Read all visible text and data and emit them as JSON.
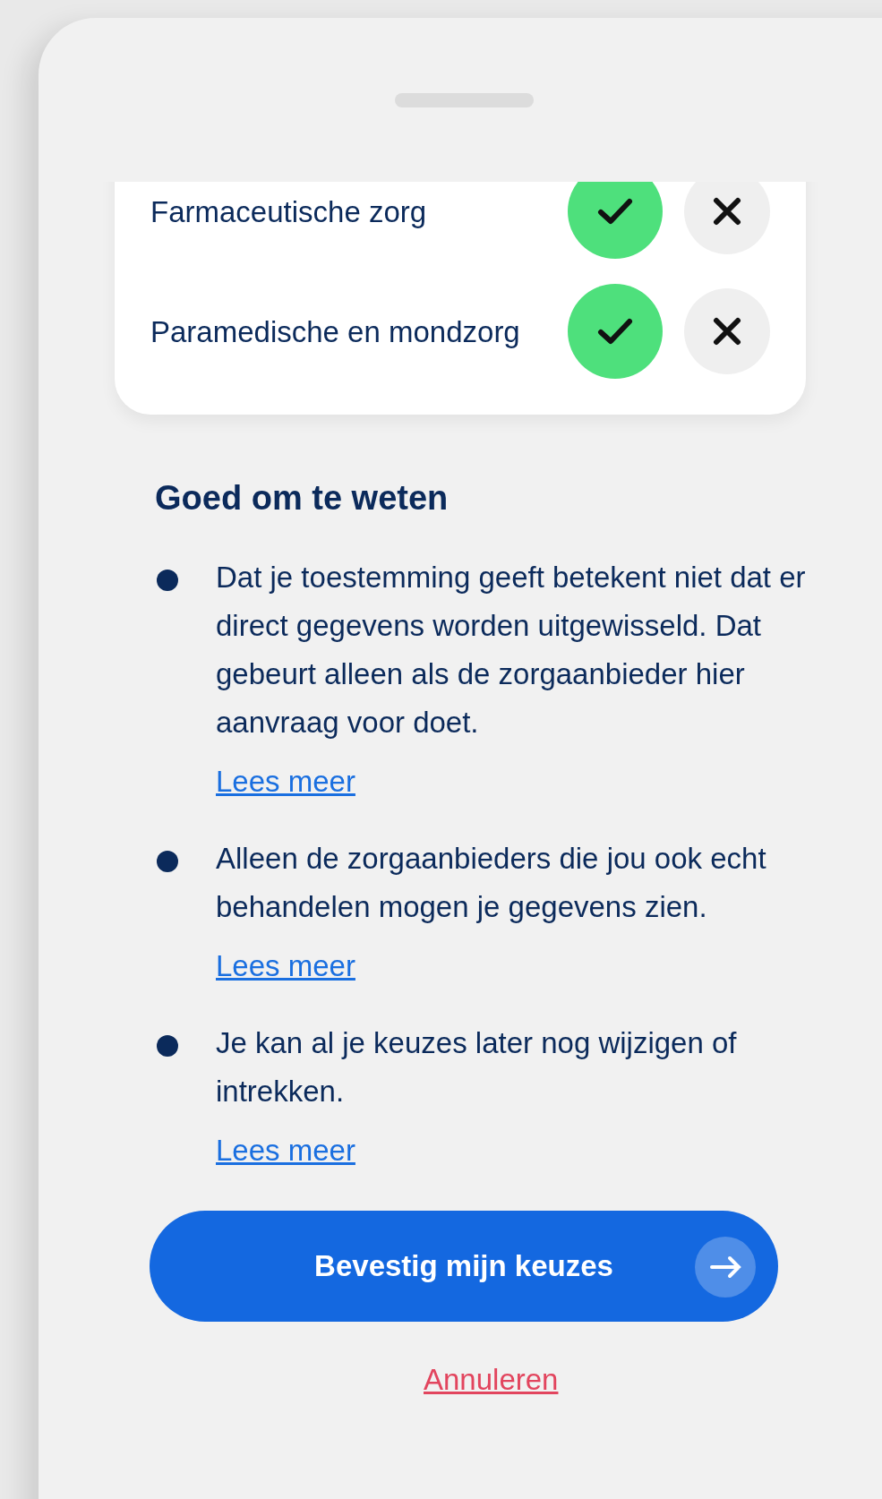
{
  "consents": [
    {
      "label": "Farmaceutische zorg",
      "options": [
        {
          "kind": "accept",
          "selected": true
        },
        {
          "kind": "reject",
          "selected": false
        }
      ]
    },
    {
      "label": "Paramedische en mondzorg",
      "options": [
        {
          "kind": "accept",
          "selected": true
        },
        {
          "kind": "reject",
          "selected": false
        }
      ]
    }
  ],
  "info": {
    "heading": "Goed om te weten",
    "items": [
      {
        "text": "Dat je toestemming geeft betekent niet dat er direct gegevens worden uitgewisseld. Dat gebeurt alleen als de zorgaanbieder hier aanvraag voor doet.",
        "link": "Lees meer"
      },
      {
        "text": "Alleen de zorgaanbieders die jou ook echt behandelen mogen je gegevens zien.",
        "link": "Lees meer"
      },
      {
        "text": "Je kan al je keuzes later nog wijzigen of intrekken.",
        "link": "Lees meer"
      }
    ]
  },
  "primary_button": {
    "label": "Bevestig mijn keuzes"
  },
  "cancel_link": "Annuleren"
}
